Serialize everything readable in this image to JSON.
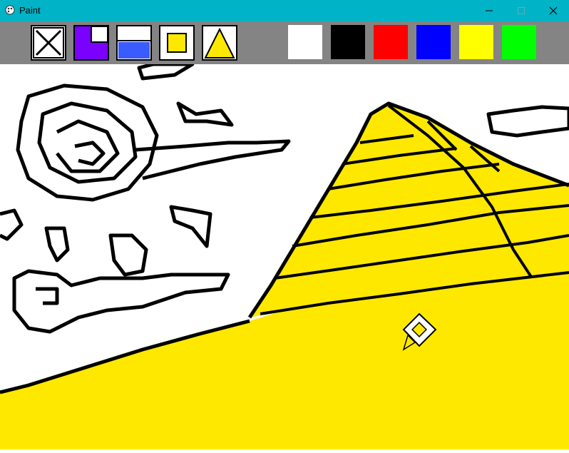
{
  "window": {
    "title": "Paint",
    "icon": "paint-palette-icon"
  },
  "controls": {
    "minimize_icon": "minimize-icon",
    "maximize_icon": "maximize-icon",
    "close_icon": "close-icon"
  },
  "tools": [
    {
      "id": "clear",
      "icon": "clear-x-icon"
    },
    {
      "id": "fill-corner",
      "icon": "fill-color-icon"
    },
    {
      "id": "half-fill",
      "icon": "half-fill-icon"
    },
    {
      "id": "square",
      "icon": "square-icon"
    },
    {
      "id": "triangle",
      "icon": "triangle-icon"
    }
  ],
  "palette": [
    {
      "name": "white",
      "hex": "#ffffff"
    },
    {
      "name": "black",
      "hex": "#000000"
    },
    {
      "name": "red",
      "hex": "#ff0000"
    },
    {
      "name": "blue",
      "hex": "#0000ff"
    },
    {
      "name": "yellow",
      "hex": "#ffff00"
    },
    {
      "name": "green",
      "hex": "#00ff00"
    }
  ],
  "colors": {
    "titlebar": "#00b3c6",
    "toolbar": "#848484",
    "fill_yellow": "#ffe800",
    "tool_purple": "#7a00ff",
    "tool_blue": "#3a5cff"
  }
}
